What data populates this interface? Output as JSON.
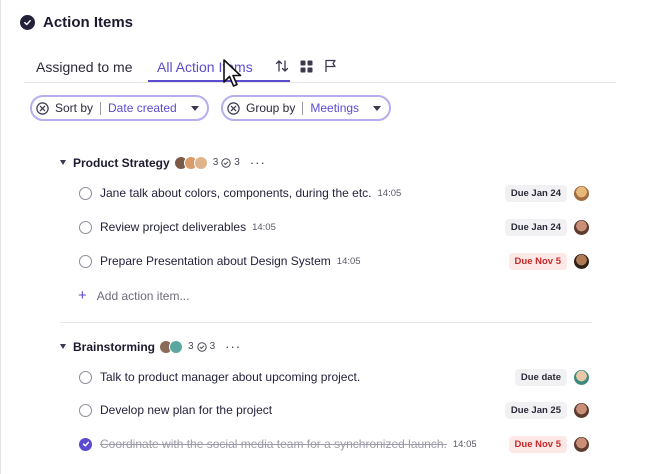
{
  "header": {
    "title": "Action Items",
    "icon": "check-circle-icon"
  },
  "tabs": [
    {
      "label": "Assigned to me",
      "active": false
    },
    {
      "label": "All Action Items",
      "active": true
    }
  ],
  "toolbar_icons": [
    "sort-arrows-icon",
    "grid-icon",
    "flag-icon"
  ],
  "filters": {
    "sort": {
      "label": "Sort by",
      "value": "Date created"
    },
    "group": {
      "label": "Group by",
      "value": "Meetings"
    }
  },
  "groups": [
    {
      "name": "Product Strategy",
      "count": "3",
      "done_count": "3",
      "more": "···",
      "items": [
        {
          "text": "Jane talk about colors, components, during the etc.",
          "time": "14:05",
          "due": "Due Jan 24",
          "overdue": false,
          "done": false
        },
        {
          "text": "Review project deliverables",
          "time": "14:05",
          "due": "Due Jan 24",
          "overdue": false,
          "done": false
        },
        {
          "text": "Prepare Presentation about Design System",
          "time": "14:05",
          "due": "Due Nov 5",
          "overdue": true,
          "done": false
        }
      ],
      "add_label": "Add action item..."
    },
    {
      "name": "Brainstorming",
      "count": "3",
      "done_count": "3",
      "more": "···",
      "items": [
        {
          "text": "Talk to product manager about upcoming project.",
          "time": "",
          "due": "Due date",
          "overdue": false,
          "done": false
        },
        {
          "text": "Develop new plan for the project",
          "time": "",
          "due": "Due Jan 25",
          "overdue": false,
          "done": false
        },
        {
          "text": "Coordinate with the social media team for a synchronized launch.",
          "time": "14:05",
          "due": "Due Nov 5",
          "overdue": true,
          "done": true
        }
      ]
    }
  ],
  "colors": {
    "accent": "#5b4ccf",
    "overdue": "#c62828",
    "overdue_bg": "#fde8e8"
  }
}
